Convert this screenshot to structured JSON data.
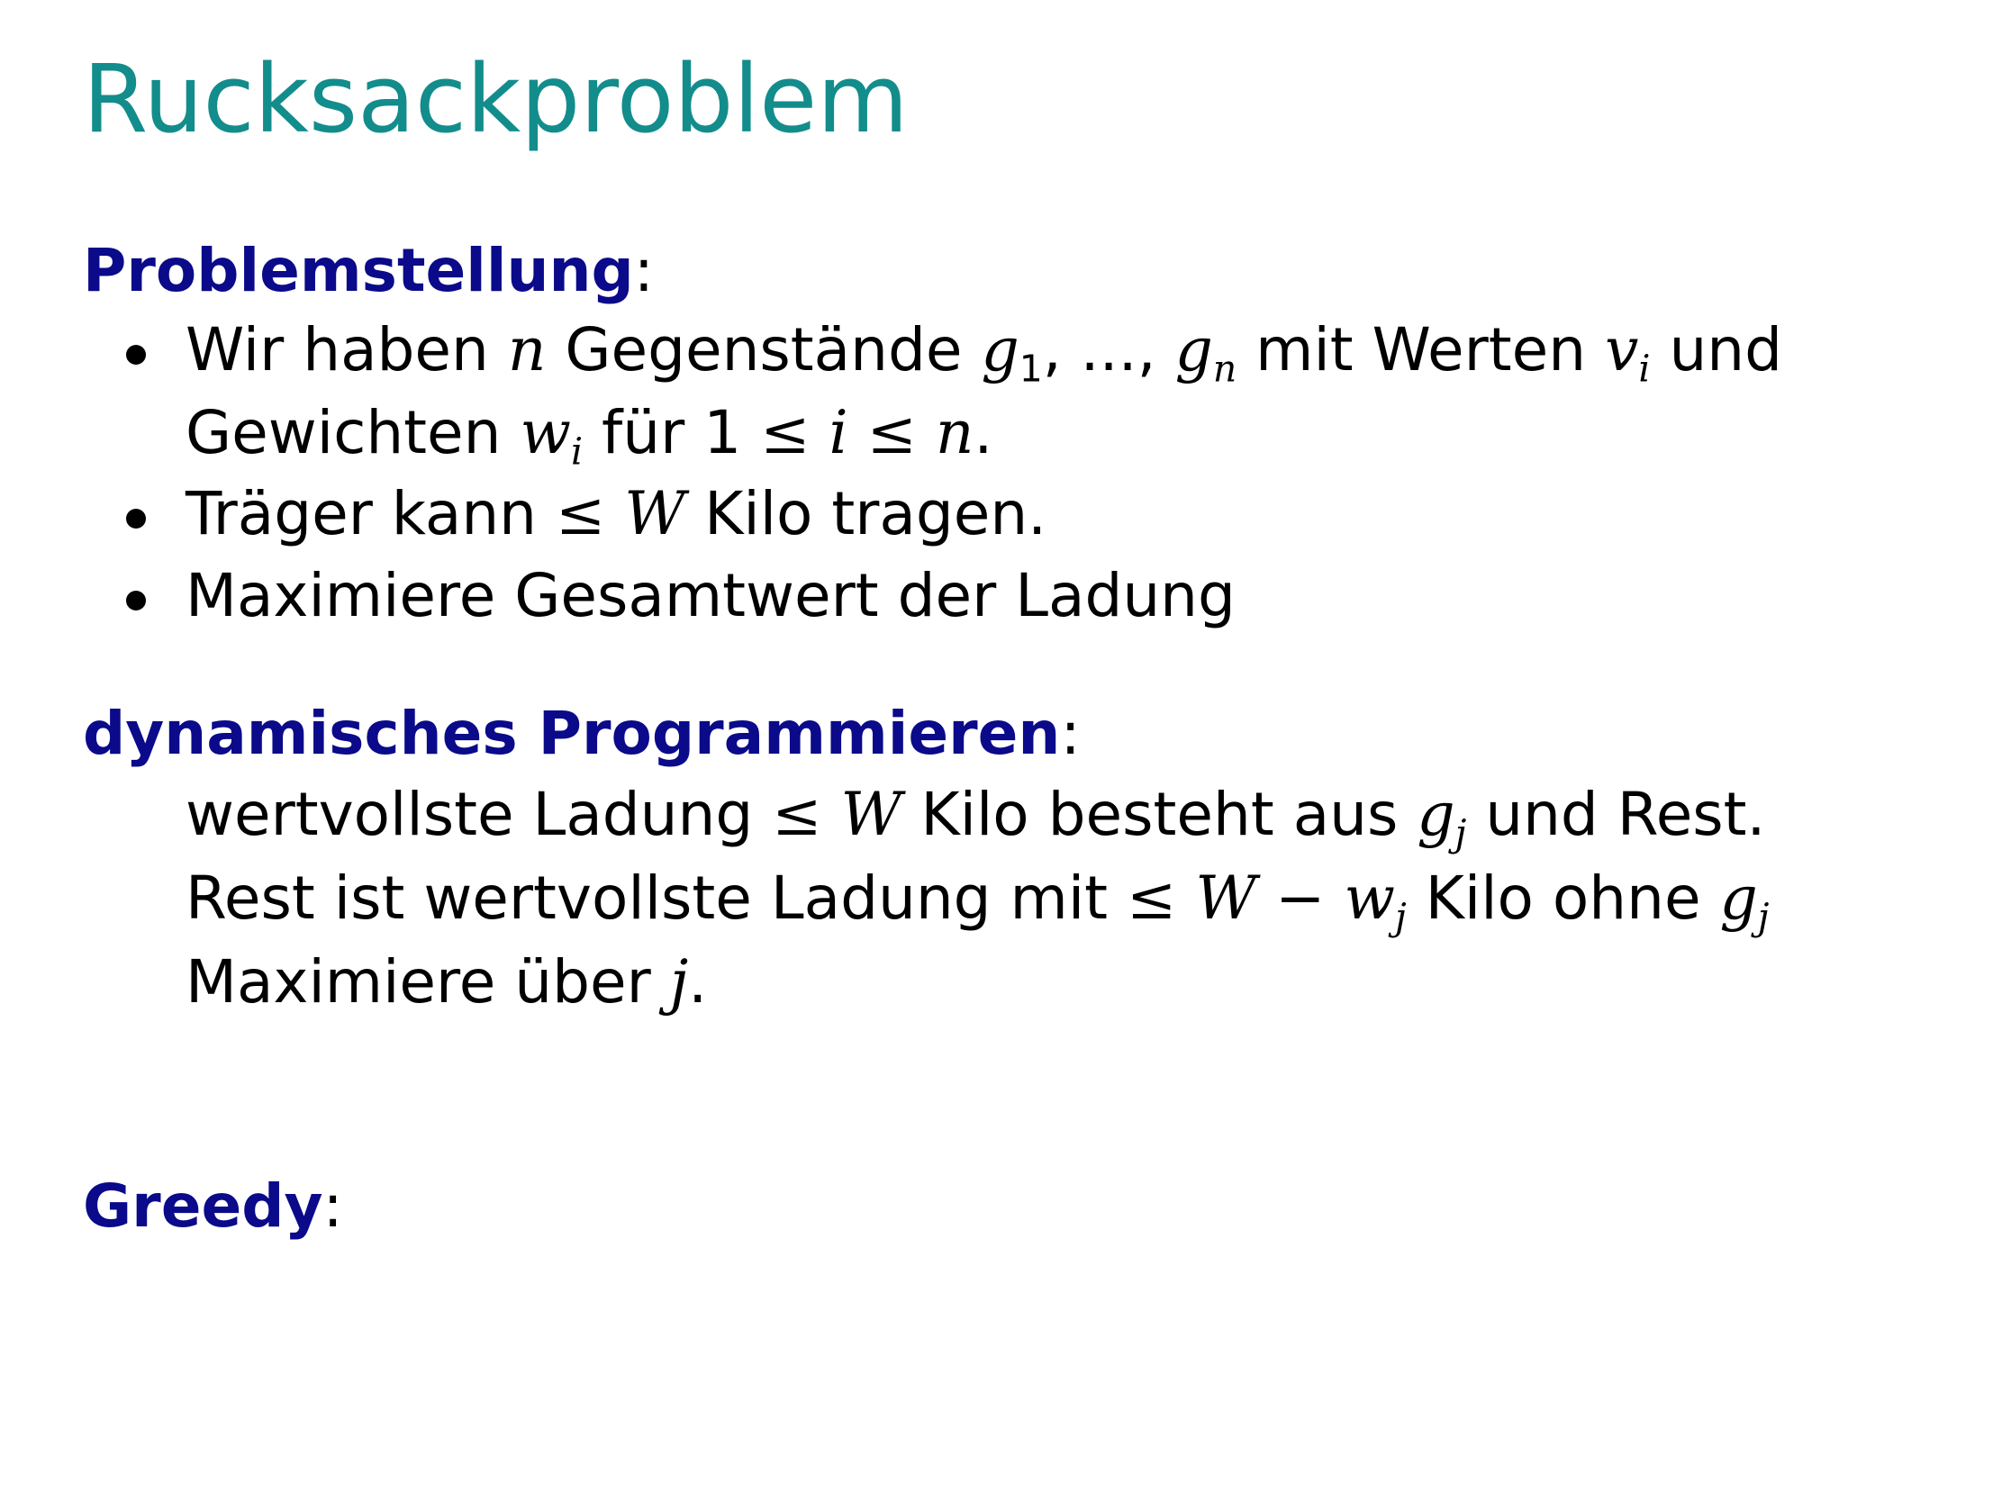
{
  "slide": {
    "title": "Rucksackproblem",
    "colors": {
      "title": "#138c8c",
      "heading": "#0a0a8a",
      "text": "#000000"
    }
  },
  "section1": {
    "heading": "Problemstellung",
    "colon": ":",
    "bullet1": {
      "t1": "Wir haben ",
      "n": "n",
      "t2": " Gegenstände ",
      "g": "g",
      "sub1": "1",
      "dots": ", ..., ",
      "g2": "g",
      "subn": "n",
      "t3": " mit Werten ",
      "v": "v",
      "subi": "i",
      "t4": " und",
      "t5": "Gewichten ",
      "w": "w",
      "subi2": "i",
      "t6": " für 1 ",
      "le1": "≤",
      "i": "i",
      "le2": "≤",
      "n2": "n",
      "t7": "."
    },
    "bullet2": {
      "t1": "Träger kann ",
      "le": "≤",
      "W": "W",
      "t2": " Kilo tragen."
    },
    "bullet3": {
      "t1": "Maximiere Gesamtwert der Ladung"
    }
  },
  "section2": {
    "heading": "dynamisches Programmieren",
    "colon": ":",
    "line1": {
      "t1": "wertvollste Ladung ",
      "le": "≤",
      "W": "W",
      "t2": " Kilo besteht aus ",
      "g": "g",
      "subj": "j",
      "t3": " und Rest."
    },
    "line2": {
      "t1": "Rest ist wertvollste Ladung mit ",
      "le": "≤",
      "W": "W",
      "minus": "−",
      "w": "w",
      "subj": "j",
      "t2": " Kilo ohne ",
      "g": "g",
      "subj2": "j"
    },
    "line3": {
      "t1": "Maximiere über ",
      "j": "j",
      "t2": "."
    }
  },
  "section3": {
    "heading": "Greedy",
    "colon": ":"
  }
}
